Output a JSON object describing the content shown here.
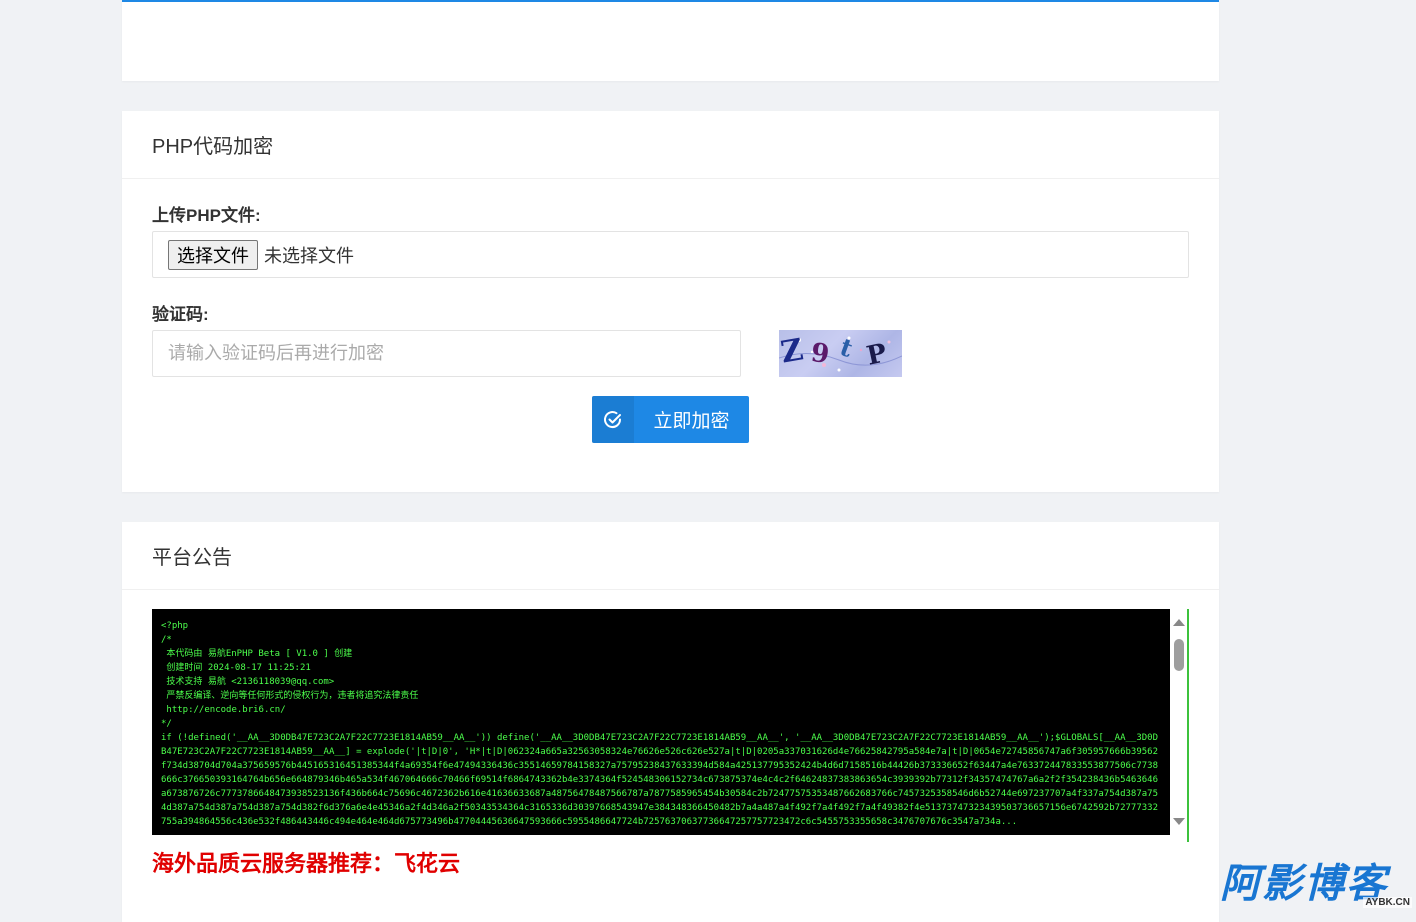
{
  "encrypt_card": {
    "title": "PHP代码加密",
    "upload_label": "上传PHP文件:",
    "file_button": "选择文件",
    "file_status": "未选择文件",
    "captcha_label": "验证码:",
    "captcha_placeholder": "请输入验证码后再进行加密",
    "captcha_chars": [
      "Z",
      "9",
      "t",
      "P"
    ],
    "submit_label": "立即加密",
    "submit_icon": "check-circle-icon"
  },
  "notice_card": {
    "title": "平台公告",
    "code_text": "<?php\n/*\n 本代码由 易航EnPHP Beta [ V1.0 ] 创建\n 创建时间 2024-08-17 11:25:21\n 技术支持 易航 <2136118039@qq.com>\n 严禁反编译、逆向等任何形式的侵权行为，违者将追究法律责任\n http://encode.bri6.cn/\n*/\nif (!defined('__AA__3D0DB47E723C2A7F22C7723E1814AB59__AA__')) define('__AA__3D0DB47E723C2A7F22C7723E1814AB59__AA__', '__AA__3D0DB47E723C2A7F22C7723E1814AB59__AA__');$GLOBALS[__AA__3D0DB47E723C2A7F22C7723E1814AB59__AA__] = explode('|t|D|0', 'H*|t|D|062324a665a32563058324e76626e526c626e527a|t|D|0205a337031626d4e76625842795a584e7a|t|D|0654e72745856747a6f305957666b39562f734d38704d704a375659576b445165316451385344f4a69354f6e47494336436c35514659784158327a75795238437633394d584a425137795352424b4d6d7158516b44426b373336652f63447a4e763372447833553877506c7738666c376650393164764b656e664879346b465a534f467064666c70466f69514f6864743362b4e3374364f524548306152734c673875374e4c4c2f64624837383863654c3939392b77312f34357474767a6a2f2f354238436b5463646a673876726c7773786648473938523136f436b664c75696c4672362b616e41636633687a48756478487566787a7877585965454b30584c2b72477575353487662683766c7457325358546d6b52744e697237707a4f337a754d387a754d387a754d387a754d387a754d382f6d376a6e4e45346a2f4d346a2f50343534364c3165336d30397668543947e384348366450482b7a4a487a4f492f7a4f492f7a4f49382f4e51373747323439503736657156e6742592b72777332755a394864556c436e532f486443446c494e464e464d675773496b47704445636647593666c5955486647724b72576370637736647257757723472c6c5455753355658c3476707676c3547a734a..."
  },
  "promo_text": "海外品质云服务器推荐：飞花云",
  "watermark": {
    "main": "阿影博客",
    "sub": "AYBK.CN"
  },
  "colors": {
    "accent": "#1e88e5",
    "promo": "#e00000",
    "code_text": "#4cff4c"
  }
}
